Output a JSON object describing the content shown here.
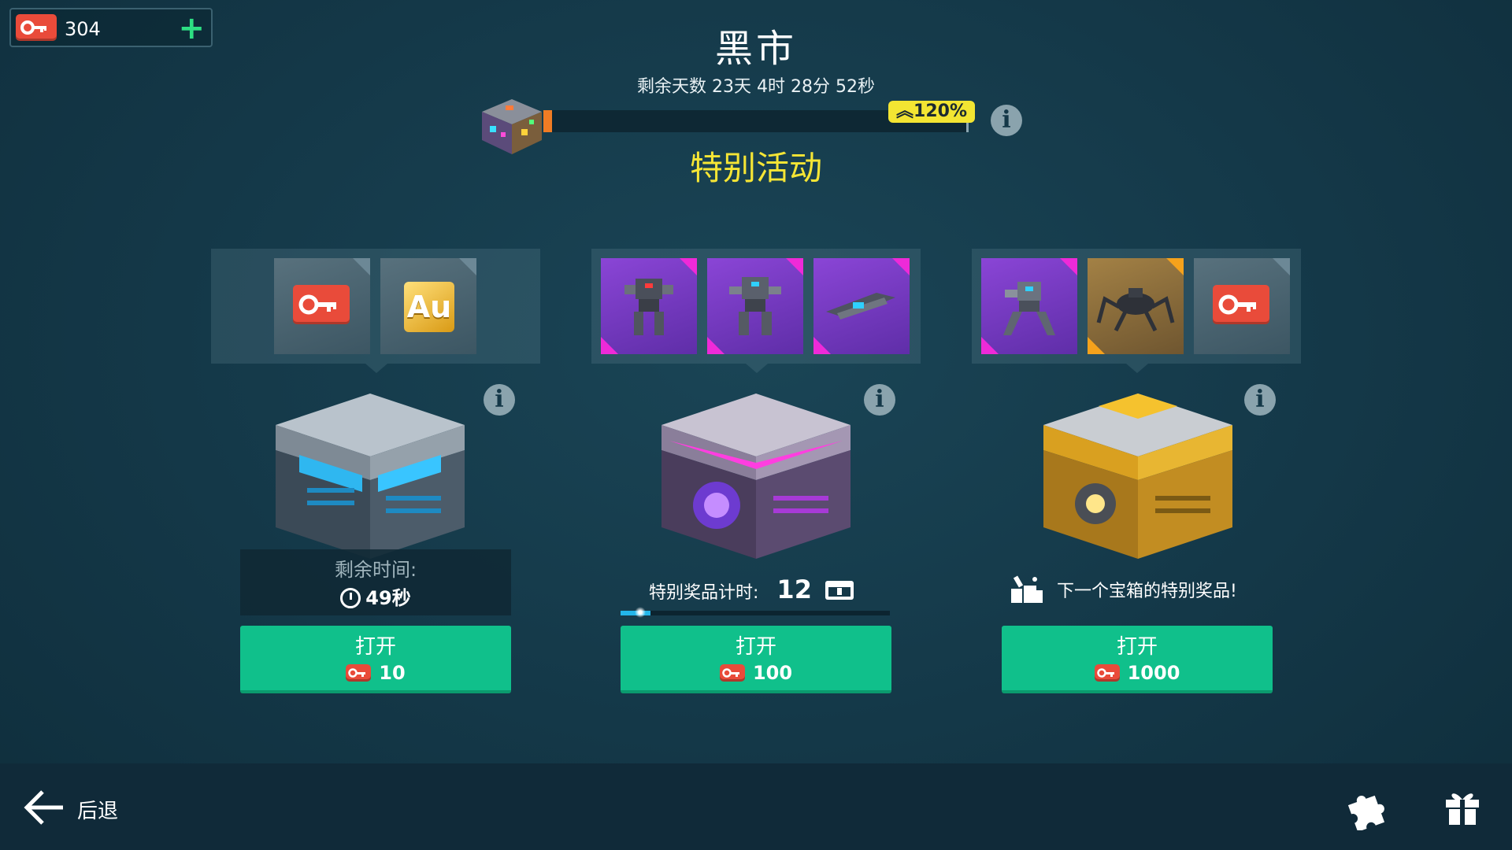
{
  "currency": {
    "keys": "304",
    "add_symbol": "+"
  },
  "header": {
    "title": "黑市",
    "time_remaining": "剩余天数 23天 4时 28分 52秒",
    "bonus": "120%",
    "event_label": "特别活动",
    "progress": 0.02
  },
  "chests": [
    {
      "tier": "blue",
      "rewards": [
        "keys-icon",
        "gold-au-icon"
      ],
      "timer_label": "剩余时间:",
      "timer_value": "49秒",
      "open_label": "打开",
      "price": "10"
    },
    {
      "tier": "purple",
      "rewards": [
        "robot-icon",
        "robot-icon",
        "weapon-icon"
      ],
      "prize_timer_label": "特别奖品计时:",
      "prize_timer_value": "12",
      "prize_progress": 0.11,
      "open_label": "打开",
      "price": "100"
    },
    {
      "tier": "gold",
      "rewards": [
        "robot-icon",
        "spider-robot-icon",
        "keys-icon"
      ],
      "next_prize_label": "下一个宝箱的特别奖品!",
      "open_label": "打开",
      "price": "1000"
    }
  ],
  "footer": {
    "back_label": "后退"
  },
  "colors": {
    "accent_green": "#10c08b",
    "key_red": "#e94b3a",
    "event_yellow": "#f5e535",
    "progress_orange": "#f07c24"
  }
}
